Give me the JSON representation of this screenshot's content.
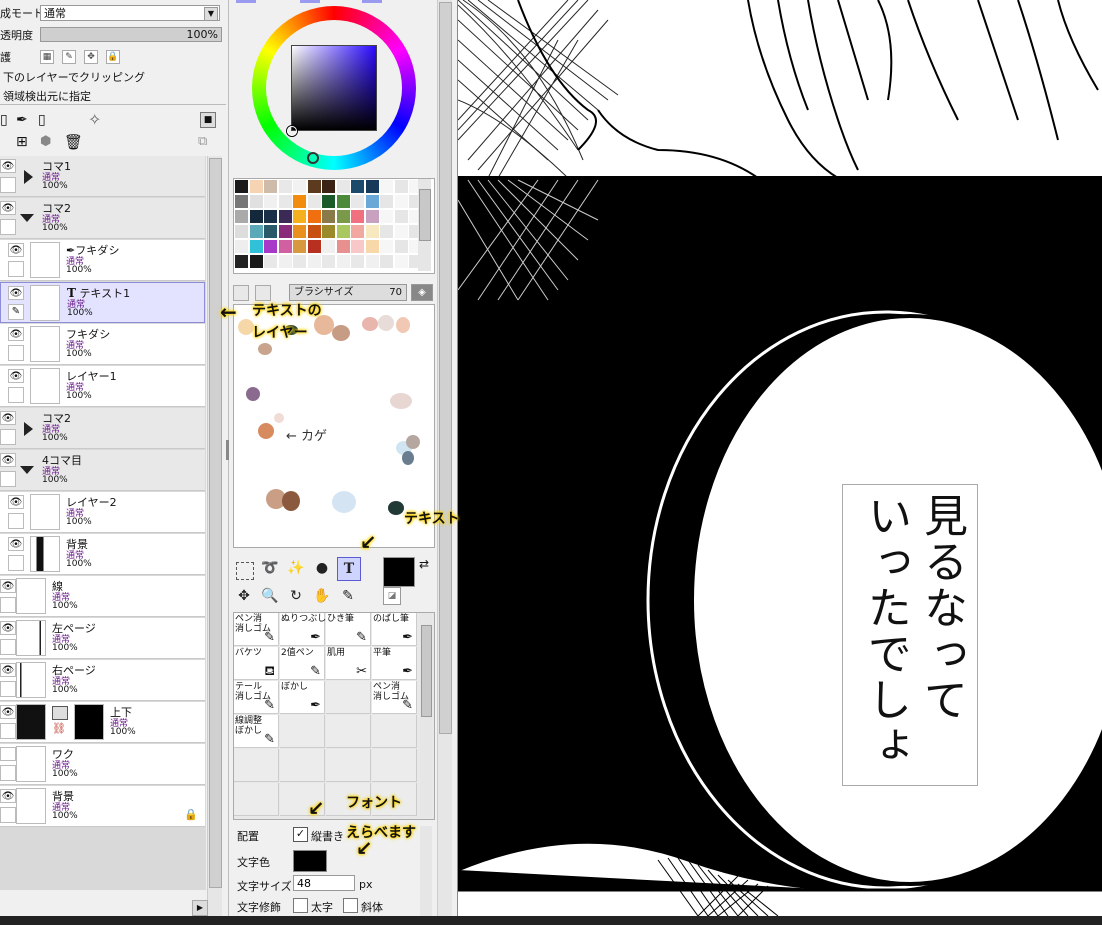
{
  "layer_props": {
    "blend_label": "成モード",
    "blend_value": "通常",
    "opacity_label": "透明度",
    "opacity_value": "100%",
    "protect_label": "護",
    "clip_label": "下のレイヤーでクリッピング",
    "source_label": "領域検出元に指定"
  },
  "layers": [
    {
      "name": "コマ1",
      "mode": "通常",
      "opacity": "100%",
      "kind": "folder-collapsed"
    },
    {
      "name": "コマ2",
      "mode": "通常",
      "opacity": "100%",
      "kind": "folder-open"
    },
    {
      "name": "フキダシ",
      "mode": "通常",
      "opacity": "100%",
      "kind": "child"
    },
    {
      "name": "テキスト1",
      "mode": "通常",
      "opacity": "100%",
      "kind": "child-selected"
    },
    {
      "name": "フキダシ",
      "mode": "通常",
      "opacity": "100%",
      "kind": "child"
    },
    {
      "name": "レイヤー1",
      "mode": "通常",
      "opacity": "100%",
      "kind": "child"
    },
    {
      "name": "コマ2",
      "mode": "通常",
      "opacity": "100%",
      "kind": "folder-collapsed"
    },
    {
      "name": "4コマ目",
      "mode": "通常",
      "opacity": "100%",
      "kind": "folder-open"
    },
    {
      "name": "レイヤー2",
      "mode": "通常",
      "opacity": "100%",
      "kind": "child"
    },
    {
      "name": "背景",
      "mode": "通常",
      "opacity": "100%",
      "kind": "child"
    },
    {
      "name": "線",
      "mode": "通常",
      "opacity": "100%",
      "kind": "top"
    },
    {
      "name": "左ページ",
      "mode": "通常",
      "opacity": "100%",
      "kind": "top"
    },
    {
      "name": "右ページ",
      "mode": "通常",
      "opacity": "100%",
      "kind": "top"
    },
    {
      "name": "上下",
      "mode": "通常",
      "opacity": "100%",
      "kind": "top-mask"
    },
    {
      "name": "ワク",
      "mode": "通常",
      "opacity": "100%",
      "kind": "top"
    },
    {
      "name": "背景",
      "mode": "通常",
      "opacity": "100%",
      "kind": "top-locked"
    }
  ],
  "brush": {
    "size_label": "ブラシサイズ",
    "size_value": "70"
  },
  "scratch_note": "← カゲ",
  "brushes": [
    "ペン消\n消しゴム",
    "ぬりつぶし",
    "ひき筆",
    "のばし筆",
    "バケツ",
    "2值ペン",
    "肌用",
    "平筆",
    "テール\n消しゴム",
    "ぼかし",
    "",
    "ペン消\n消しゴム",
    "線調整\nぼかし",
    "",
    "",
    ""
  ],
  "text_tool": {
    "layout_label": "配置",
    "vertical_label": "縦書き",
    "color_label": "文字色",
    "size_label": "文字サイズ",
    "size_value": "48",
    "size_unit": "px",
    "deco_label": "文字修飾",
    "bold_label": "太字",
    "italic_label": "斜体"
  },
  "annotations": {
    "text_layer": "テキストの\nレイヤー",
    "text_tool": "テキスト",
    "font": "フォント\nえらべます"
  },
  "canvas_text": "見るなって\nいったでしょ",
  "colors": {
    "accent_sel": "#e3e3ff",
    "text_color": "#000000",
    "annot_glow": "#ffd400"
  }
}
